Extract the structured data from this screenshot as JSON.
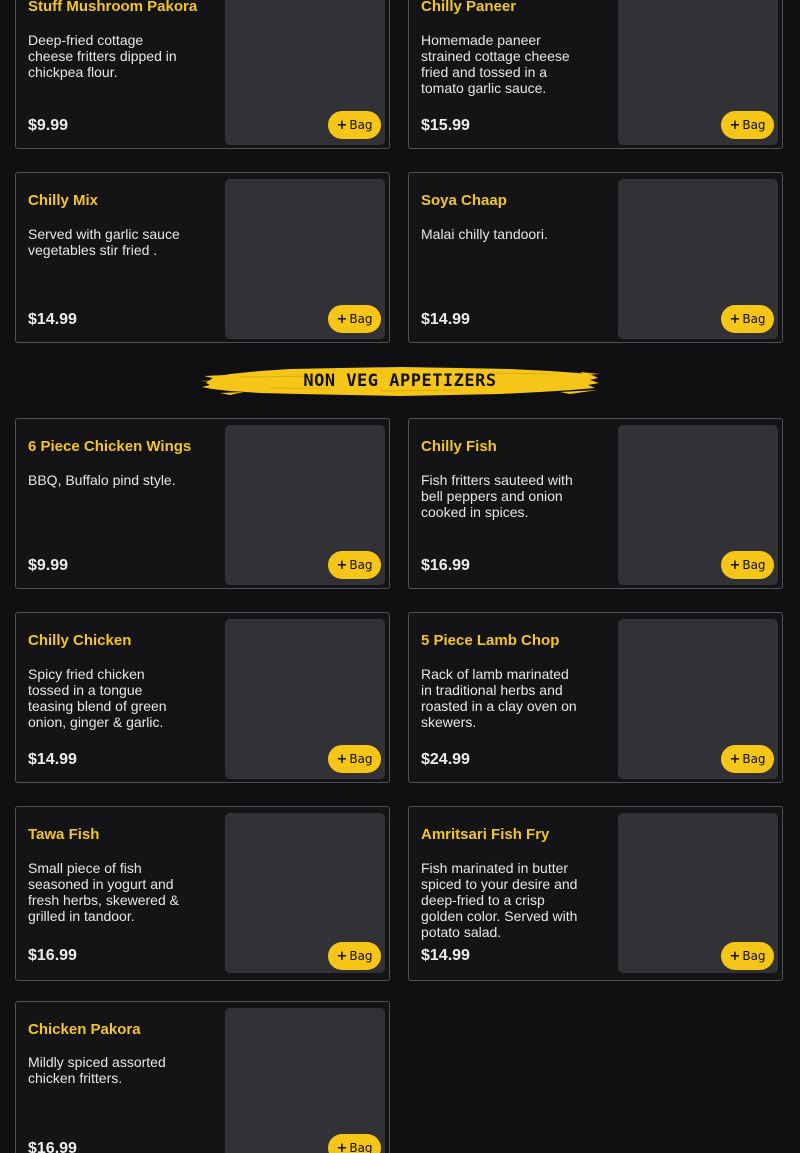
{
  "bag_label": "Bag",
  "colors": {
    "accent": "#f5c518",
    "title": "#f3c525",
    "background": "#101012",
    "card_image": "#323236"
  },
  "section_banner": "NON VEG APPETIZERS",
  "items": [
    {
      "name": "Stuff Mushroom Pakora",
      "description": "Deep-fried cottage cheese fritters dipped in chickpea flour.",
      "price": "$9.99"
    },
    {
      "name": "Chilly Paneer",
      "description": "Homemade paneer strained cottage cheese fried and tossed in a tomato garlic sauce.",
      "price": "$15.99"
    },
    {
      "name": "Chilly Mix",
      "description": "Served with garlic sauce vegetables stir fried .",
      "price": "$14.99"
    },
    {
      "name": "Soya Chaap",
      "description": "Malai chilly tandoori.",
      "price": "$14.99"
    },
    {
      "name": "6 Piece Chicken Wings",
      "description": "BBQ, Buffalo pind style.",
      "price": "$9.99"
    },
    {
      "name": "Chilly Fish",
      "description": "Fish fritters sauteed with bell peppers and onion cooked in spices.",
      "price": "$16.99"
    },
    {
      "name": "Chilly Chicken",
      "description": "Spicy fried chicken tossed in a tongue teasing blend of green onion, ginger & garlic.",
      "price": "$14.99"
    },
    {
      "name": "5 Piece Lamb Chop",
      "description": "Rack of lamb marinated in traditional herbs and roasted in a clay oven on skewers.",
      "price": "$24.99"
    },
    {
      "name": "Tawa Fish",
      "description": "Small piece of fish seasoned in yogurt and fresh herbs, skewered & grilled in tandoor.",
      "price": "$16.99"
    },
    {
      "name": "Amritsari Fish Fry",
      "description": "Fish marinated in butter spiced to your desire and deep-fried to a crisp golden color. Served with potato salad.",
      "price": "$14.99"
    },
    {
      "name": "Chicken Pakora",
      "description": "Mildly spiced assorted chicken fritters.",
      "price": "$16.99"
    }
  ]
}
